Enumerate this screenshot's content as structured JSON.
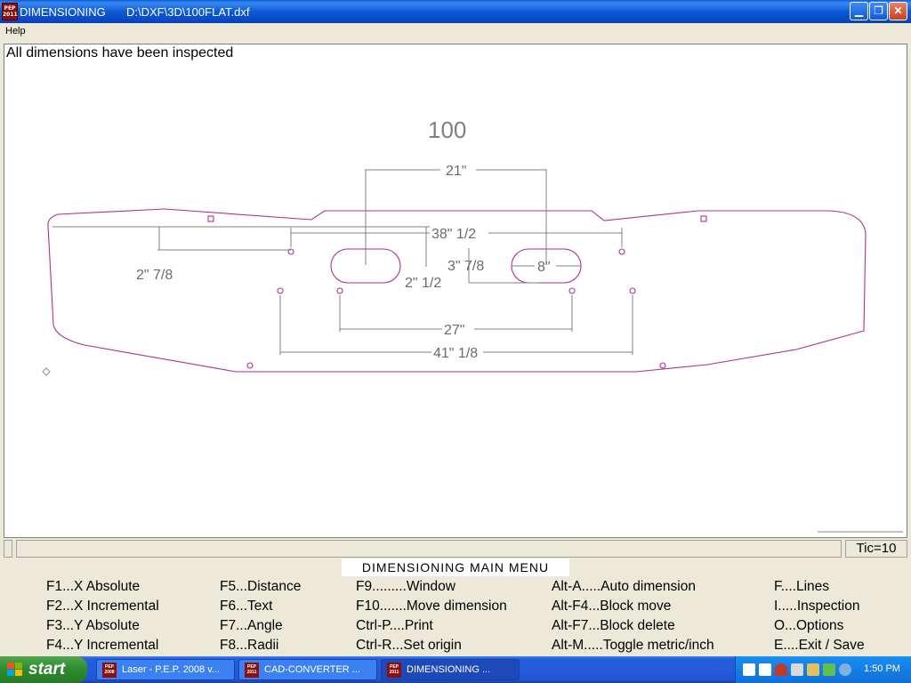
{
  "window": {
    "app_name": "DIMENSIONING",
    "file_path": "D:\\DXF\\3D\\100FLAT.dxf",
    "icon_text": "PEP 2011"
  },
  "menu": {
    "help": "Help"
  },
  "canvas": {
    "status_message": "All dimensions have been inspected",
    "part_label": "100",
    "dimensions": {
      "top": "21\"",
      "outer_holes": "38\" 1/2",
      "left_height": "2\" 7/8",
      "slot_height": "2\" 1/2",
      "right_height": "3\" 7/8",
      "slot_width": "8\"",
      "inner_holes": "27\"",
      "bottom_holes": "41\" 1/8"
    },
    "colors": {
      "outline": "#b0308f",
      "dimension": "#808080",
      "dim_text": "#6a6a6a"
    }
  },
  "statusbar": {
    "tic": "Tic=10"
  },
  "main_menu": {
    "title": "DIMENSIONING MAIN MENU",
    "col1": [
      "F1...X Absolute",
      "F2...X Incremental",
      "F3...Y Absolute",
      "F4...Y Incremental"
    ],
    "col2": [
      "F5...Distance",
      "F6...Text",
      "F7...Angle",
      "F8...Radii"
    ],
    "col3": [
      "F9.........Window",
      "F10.......Move dimension",
      "Ctrl-P....Print",
      "Ctrl-R...Set origin"
    ],
    "col4": [
      "Alt-A.....Auto dimension",
      "Alt-F4...Block move",
      "Alt-F7...Block delete",
      "Alt-M.....Toggle metric/inch"
    ],
    "col5": [
      "F....Lines",
      "I.....Inspection",
      "O...Options",
      "E....Exit / Save"
    ]
  },
  "taskbar": {
    "start": "start",
    "tasks": [
      "Laser - P.E.P. 2008 v...",
      "CAD-CONVERTER      ...",
      "DIMENSIONING      ..."
    ],
    "clock": "1:50 PM"
  }
}
